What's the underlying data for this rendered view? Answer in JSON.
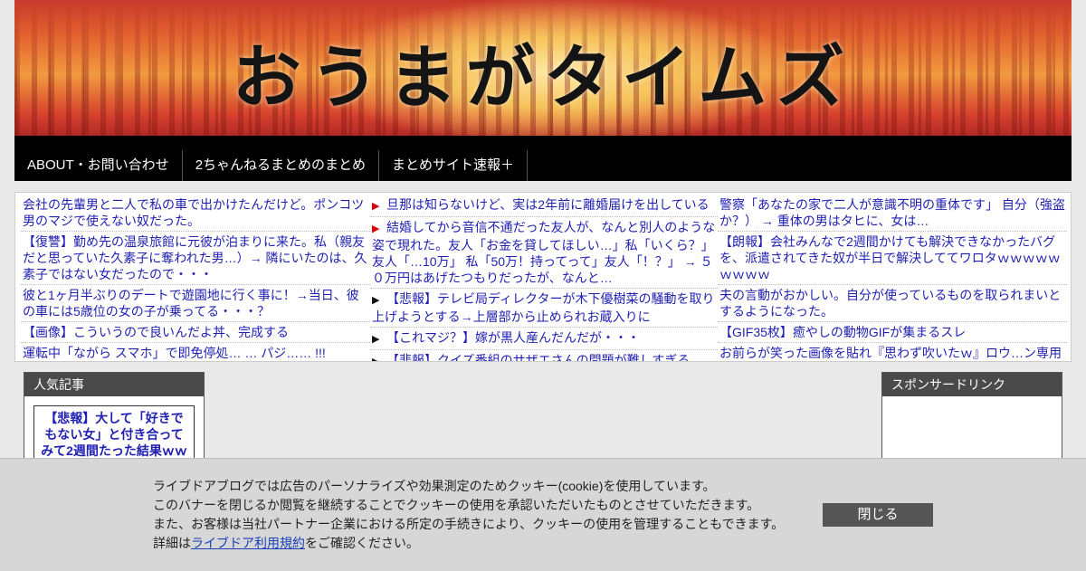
{
  "site": {
    "title": "おうまがタイムズ"
  },
  "nav": {
    "items": [
      "ABOUT・お問い合わせ",
      "2ちゃんねるまとめのまとめ",
      "まとめサイト速報＋"
    ]
  },
  "feed": {
    "col1": [
      "会社の先輩男と二人で私の車で出かけたんだけど。ポンコツ男のマジで使えない奴だった。",
      "【復讐】勤め先の温泉旅館に元彼が泊まりに来た。私（親友だと思っていた久素子に奪われた男…）→ 隣にいたのは、久素子ではない女だったので・・・",
      "彼と1ヶ月半ぶりのデートで遊園地に行く事に！→当日、彼の車には5歳位の女の子が乗ってる・・・？",
      "【画像】こういうので良いんだよ丼、完成する",
      "運転中「ながら スマホ」で即免停処… … パジ…… !!!"
    ],
    "col2": [
      "旦那は知らないけど、実は2年前に離婚届けを出している",
      "結婚してから音信不通だった友人が、なんと別人のような姿で現れた。友人「お金を貸してほしい…」私「いくら？」友人「…10万」 私「50万！持ってって」友人「！？」 → ５０万円はあげたつもりだったが、なんと…",
      "【悲報】テレビ局ディレクターが木下優樹菜の騒動を取り上げようとする→上層部から止められお蔵入りに",
      "【これマジ？】嫁が黒人産んだんだが・・・",
      "【悲報】クイズ番組のサザエさんの問題が難しすぎる……"
    ],
    "col3": [
      "警察「あなたの家で二人が意識不明の重体です」 自分（強盗か？） → 重体の男はタヒに、女は…",
      "【朗報】会社みんなで2週間かけても解決できなかったバグを、派遣されてきた奴が半日で解決しててワロタｗｗｗｗｗｗｗｗｗ",
      "夫の言動がおかしい。自分が使っているものを取られまいとするようになった。",
      "【GIF35枚】癒やしの動物GIFが集まるスレ",
      "お前らが笑った画像を貼れ『思わず吹いたｗ』ロウ…ン専用"
    ],
    "bullets": [
      "▶",
      "▶",
      "▶",
      "▶",
      "▶"
    ],
    "bullet_colors": {
      "red": "#dd0000",
      "black": "#111111"
    }
  },
  "popular": {
    "header": "人気記事",
    "card": "【悲報】大して「好きでもない女」と付き合ってみて2週間たった結果ｗｗ"
  },
  "sponsor": {
    "header": "スポンサードリンク"
  },
  "cookie": {
    "line1": "ライブドアブログでは広告のパーソナライズや効果測定のためクッキー(cookie)を使用しています。",
    "line2": "このバナーを閉じるか閲覧を継続することでクッキーの使用を承認いただいたものとさせていただきます。",
    "line3": "また、お客様は当社パートナー企業における所定の手続きにより、クッキーの使用を管理することもできます。",
    "line4_prefix": "詳細は",
    "line4_link": "ライブドア利用規約",
    "line4_suffix": "をご確認ください。",
    "close": "閉じる"
  },
  "colors": {
    "link": "#1f1fb3",
    "nav_bg": "#000000",
    "box_header": "#4a4a4a",
    "cookie_bg": "#d7d7d7",
    "close_btn": "#555555"
  }
}
